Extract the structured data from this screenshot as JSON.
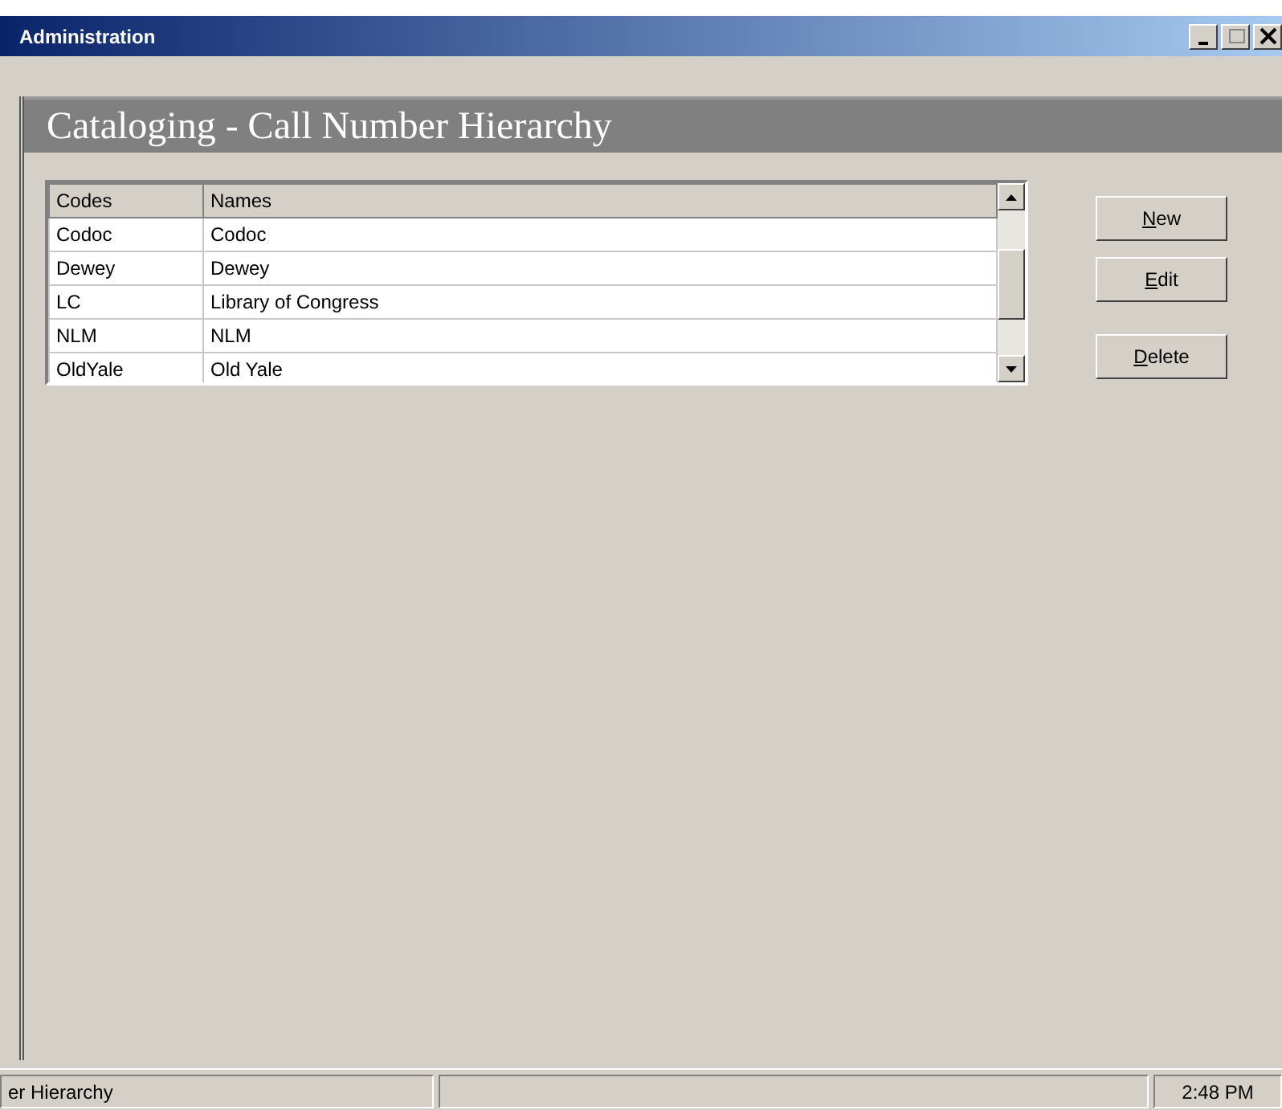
{
  "window": {
    "title": "Administration"
  },
  "header": {
    "title": "Cataloging - Call Number Hierarchy"
  },
  "table": {
    "columns": [
      "Codes",
      "Names"
    ],
    "rows": [
      [
        "Codoc",
        "Codoc"
      ],
      [
        "Dewey",
        "Dewey"
      ],
      [
        "LC",
        "Library of Congress"
      ],
      [
        "NLM",
        "NLM"
      ],
      [
        "OldYale",
        "Old Yale"
      ]
    ]
  },
  "buttons": [
    "New",
    "Edit",
    "Delete"
  ],
  "status_bar": {
    "message": "er Hierarchy",
    "time": "2:48 PM"
  }
}
